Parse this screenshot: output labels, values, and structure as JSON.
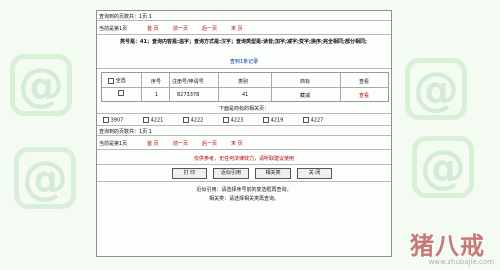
{
  "page_info": {
    "total_pages_text": "查询到的页数共：1页  1",
    "current_page_text": "当前是第1页",
    "first_page": "首 页",
    "prev_page": "前一页",
    "next_page": "后一页",
    "last_page": "末 页"
  },
  "search_header": {
    "query_desc": "类号是：41；查询内容是:溢字；查询方式是:汉字；查询类型是:读音;加字;减字;变字;换序;完全相同;部分相同;",
    "result_count": "查到1条记录"
  },
  "results_table": {
    "columns": [
      "全选",
      "序号",
      "注册号/申请号",
      "类别",
      "商标",
      "查看"
    ],
    "rows": [
      {
        "index": "1",
        "reg_no": "8273378",
        "class": "41",
        "trademark": "藏减",
        "view": "查看"
      }
    ]
  },
  "similar_section": {
    "title": "下面是商标的相关页：",
    "items": [
      "3907",
      "4221",
      "4222",
      "4223",
      "4219",
      "4227"
    ]
  },
  "bottom_pager": {
    "total_pages_text": "查询到的页数共：1页  1",
    "current_page_text": "当前是第1页",
    "first_page": "首 页",
    "prev_page": "前一页",
    "next_page": "后一页",
    "last_page": "末 页"
  },
  "notice": "仅供参考，无任何法律效力，请听取建议使用",
  "buttons": {
    "print": "打 印",
    "similar_cite": "近似引用",
    "related": "相关类",
    "close": "关 闭"
  },
  "help": {
    "similar_cite": "近似引用：请选择序号前的复选框再查询。",
    "related": "相关类：请选择相关类再查询。"
  },
  "watermark": {
    "text": "猪八戒",
    "url": "www.zhubajie.com"
  },
  "colors": {
    "background": "#f3fbf3",
    "link_red": "#b00000",
    "link_blue": "#0033aa"
  }
}
